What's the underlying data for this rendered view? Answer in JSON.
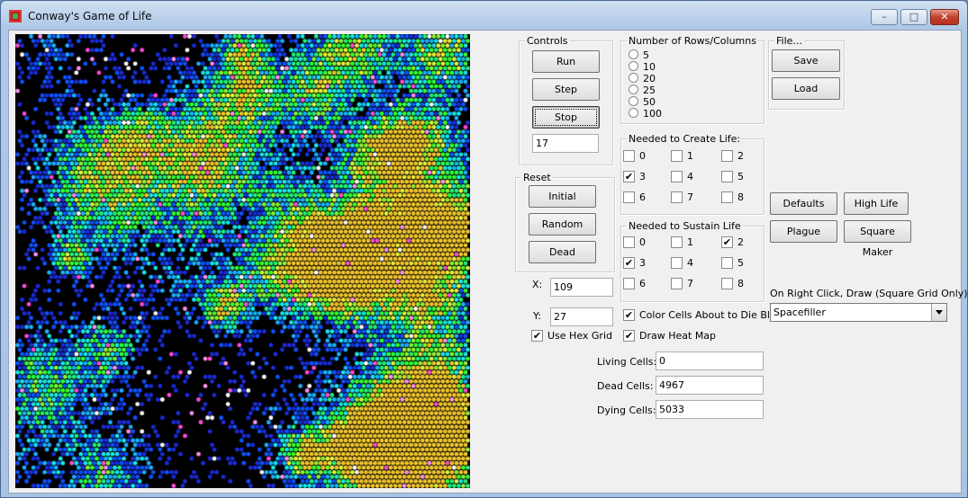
{
  "window": {
    "title": "Conway's Game of Life",
    "minimize": "–",
    "maximize": "□",
    "close": "✕"
  },
  "grid": {
    "rows": 100,
    "cols": 100,
    "palette": [
      "#000000",
      "#1a2bd9",
      "#0d52ff",
      "#1bb0ff",
      "#17e8e8",
      "#21f07a",
      "#33ff33",
      "#8cf237",
      "#e6f23a",
      "#f0c52e",
      "#ff4bd6",
      "#ff8ff0",
      "#ffffff"
    ]
  },
  "controls": {
    "title": "Controls",
    "run": "Run",
    "step": "Step",
    "stop": "Stop",
    "interval": "17"
  },
  "reset": {
    "title": "Reset",
    "initial": "Initial",
    "random": "Random",
    "dead": "Dead"
  },
  "coords": {
    "x_label": "X:",
    "x_value": "109",
    "y_label": "Y:",
    "y_value": "27"
  },
  "hex": {
    "label": "Use Hex Grid",
    "checked": true
  },
  "rows_cols": {
    "title": "Number of Rows/Columns",
    "options": [
      "5",
      "10",
      "20",
      "25",
      "50",
      "100"
    ]
  },
  "create_life": {
    "title": "Needed to Create Life:",
    "options": [
      "0",
      "1",
      "2",
      "3",
      "4",
      "5",
      "6",
      "7",
      "8"
    ],
    "checked": [
      false,
      false,
      false,
      true,
      false,
      false,
      false,
      false,
      false
    ]
  },
  "sustain_life": {
    "title": "Needed to Sustain Life",
    "options": [
      "0",
      "1",
      "2",
      "3",
      "4",
      "5",
      "6",
      "7",
      "8"
    ],
    "checked": [
      false,
      false,
      true,
      true,
      false,
      false,
      false,
      false,
      false
    ]
  },
  "options": {
    "color_dying": "Color Cells About to Die Blue",
    "color_dying_checked": true,
    "heat_map": "Draw Heat Map",
    "heat_map_checked": true
  },
  "file": {
    "title": "File...",
    "save": "Save",
    "load": "Load"
  },
  "presets": {
    "defaults": "Defaults",
    "high_life": "High Life",
    "plague": "Plague",
    "square_maker": "Square Maker"
  },
  "draw": {
    "label": "On Right Click, Draw (Square Grid Only):",
    "selected": "Spacefiller"
  },
  "stats": {
    "living_label": "Living Cells:",
    "living_value": "0",
    "dead_label": "Dead Cells:",
    "dead_value": "4967",
    "dying_label": "Dying Cells:",
    "dying_value": "5033"
  }
}
